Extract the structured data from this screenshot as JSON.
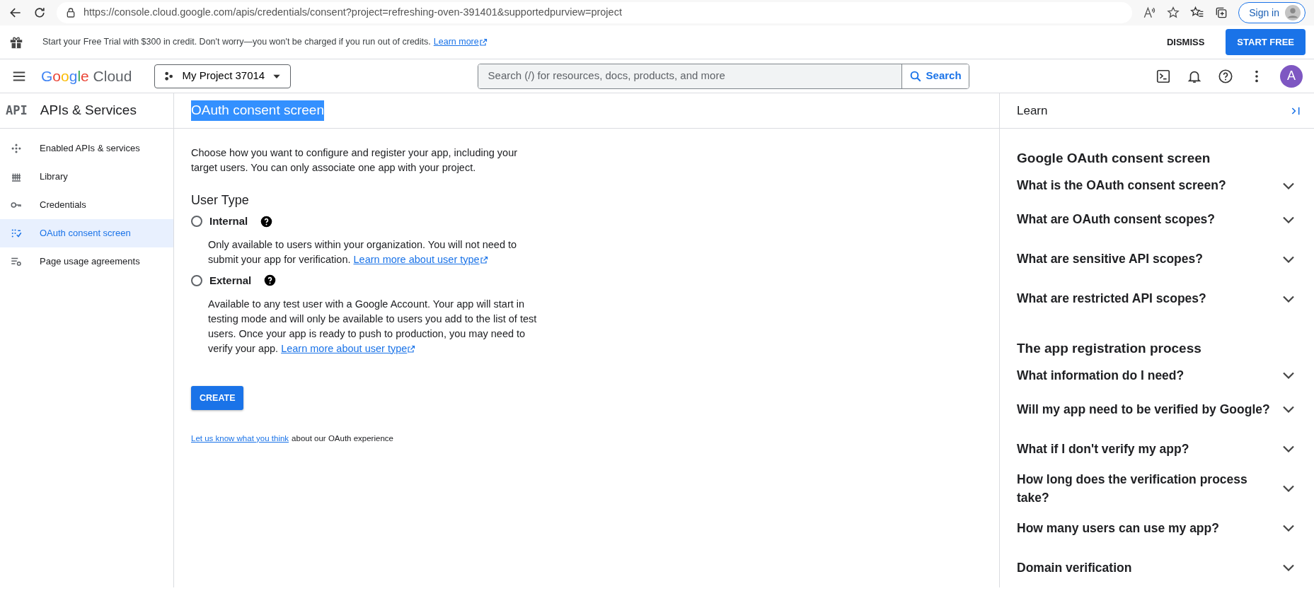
{
  "browser": {
    "url": "https://console.cloud.google.com/apis/credentials/consent?project=refreshing-oven-391401&supportedpurview=project",
    "sign_in": "Sign in"
  },
  "banner": {
    "text": "Start your Free Trial with $300 in credit. Don't worry—you won't be charged if you run out of credits.",
    "link": "Learn more",
    "dismiss": "DISMISS",
    "start": "START FREE"
  },
  "header": {
    "logo_google": "Google",
    "logo_cloud": "Cloud",
    "project": "My Project 37014",
    "search_placeholder": "Search (/) for resources, docs, products, and more",
    "search_button": "Search",
    "avatar": "A"
  },
  "sidebar": {
    "badge": "API",
    "title": "APIs & Services",
    "items": [
      {
        "label": "Enabled APIs & services",
        "selected": false
      },
      {
        "label": "Library",
        "selected": false
      },
      {
        "label": "Credentials",
        "selected": false
      },
      {
        "label": "OAuth consent screen",
        "selected": true
      },
      {
        "label": "Page usage agreements",
        "selected": false
      }
    ]
  },
  "main": {
    "title": "OAuth consent screen",
    "intro": "Choose how you want to configure and register your app, including your target users. You can only associate one app with your project.",
    "section": "User Type",
    "options": [
      {
        "label": "Internal",
        "selected": false,
        "description": "Only available to users within your organization. You will not need to submit your app for verification.",
        "link": "Learn more about user type"
      },
      {
        "label": "External",
        "selected": false,
        "description": "Available to any test user with a Google Account. Your app will start in testing mode and will only be available to users you add to the list of test users. Once your app is ready to push to production, you may need to verify your app.",
        "link": "Learn more about user type"
      }
    ],
    "create": "CREATE",
    "feedback_link": "Let us know what you think",
    "feedback_text": "about our OAuth experience"
  },
  "learn": {
    "title": "Learn",
    "sections": [
      {
        "heading": "Google OAuth consent screen",
        "items": [
          {
            "label": "What is the OAuth consent screen?",
            "expanded": false
          },
          {
            "label": "What are OAuth consent scopes?",
            "expanded": false
          },
          {
            "label": "What are sensitive API scopes?",
            "expanded": false
          },
          {
            "label": "What are restricted API scopes?",
            "expanded": false
          }
        ]
      },
      {
        "heading": "The app registration process",
        "items": [
          {
            "label": "What information do I need?",
            "expanded": false
          },
          {
            "label": "Will my app need to be verified by Google?",
            "expanded": false
          },
          {
            "label": "What if I don't verify my app?",
            "expanded": false
          },
          {
            "label": "How long does the verification process take?",
            "expanded": false
          },
          {
            "label": "How many users can use my app?",
            "expanded": false
          },
          {
            "label": "Domain verification",
            "expanded": false
          }
        ]
      }
    ]
  }
}
